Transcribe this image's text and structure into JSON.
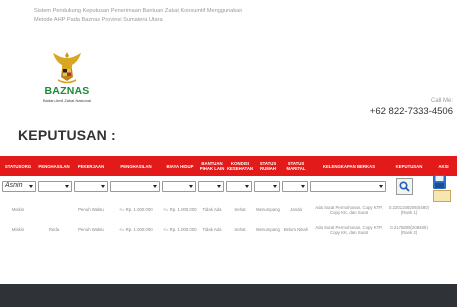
{
  "header": {
    "system_title": "Sistem Pendukung Keputusan Penerimaan Bantuan Zakat Konsumtif Menggunakan",
    "system_subtitle": "Metode AHP Pada Baznas Provinsi Sumatera Utara"
  },
  "brand": {
    "name": "BAZNAS",
    "tagline": "Badan Amil Zakat Nasional",
    "color": "#1a8a3a"
  },
  "contact": {
    "label": "Call Me:",
    "phone": "+62 822-7333-4506"
  },
  "section": {
    "title": "KEPUTUSAN :"
  },
  "table": {
    "header_color": "#e21a1a",
    "columns": [
      "STATUSORG",
      "PENGHASILAN",
      "PEKERJAAN",
      "PENGHASILAN",
      "BIAYA HIDUP",
      "BANTUAN PIHAK LAIN",
      "KONDISI KESEHATAN",
      "STATUS RUMAH",
      "STATUS MARITAL",
      "KELENGKAPAN BERKAS",
      "KEPUTUSAN",
      "AKSI"
    ],
    "filters": [
      {
        "value": "Asnin"
      },
      {
        "value": ""
      },
      {
        "value": ""
      },
      {
        "value": ""
      },
      {
        "value": ""
      },
      {
        "value": ""
      },
      {
        "value": ""
      },
      {
        "value": ""
      },
      {
        "value": ""
      },
      {
        "value": ""
      }
    ],
    "rows": [
      {
        "cells": [
          "Miskin",
          "",
          "Penuh Waktu",
          "<= Rp. 1.000.000",
          "<= Rp. 1.000.000",
          "Tidak Ada",
          "Sehat",
          "Menumpang",
          "Janda",
          "Ada Surat Permohonan, Copy KTP, Copy KK, dan Surat",
          "0.2201349206(5480) (Rank 1)"
        ]
      },
      {
        "cells": [
          "Miskin",
          "Reda",
          "Penuh Waktu",
          "<= Rp. 1.000.000",
          "<= Rp. 1.000.000",
          "Tidak Ada",
          "Sehat",
          "Menumpang",
          "Belum Nikah",
          "Ada Surat Permohonan, Copy KTP, Copy KK, dan Surat",
          "0.2175809(208480) (Rank 2)"
        ]
      }
    ]
  },
  "icons": {
    "search": "search-icon",
    "save": "save-icon",
    "dropdown": "chevron-down-icon"
  }
}
